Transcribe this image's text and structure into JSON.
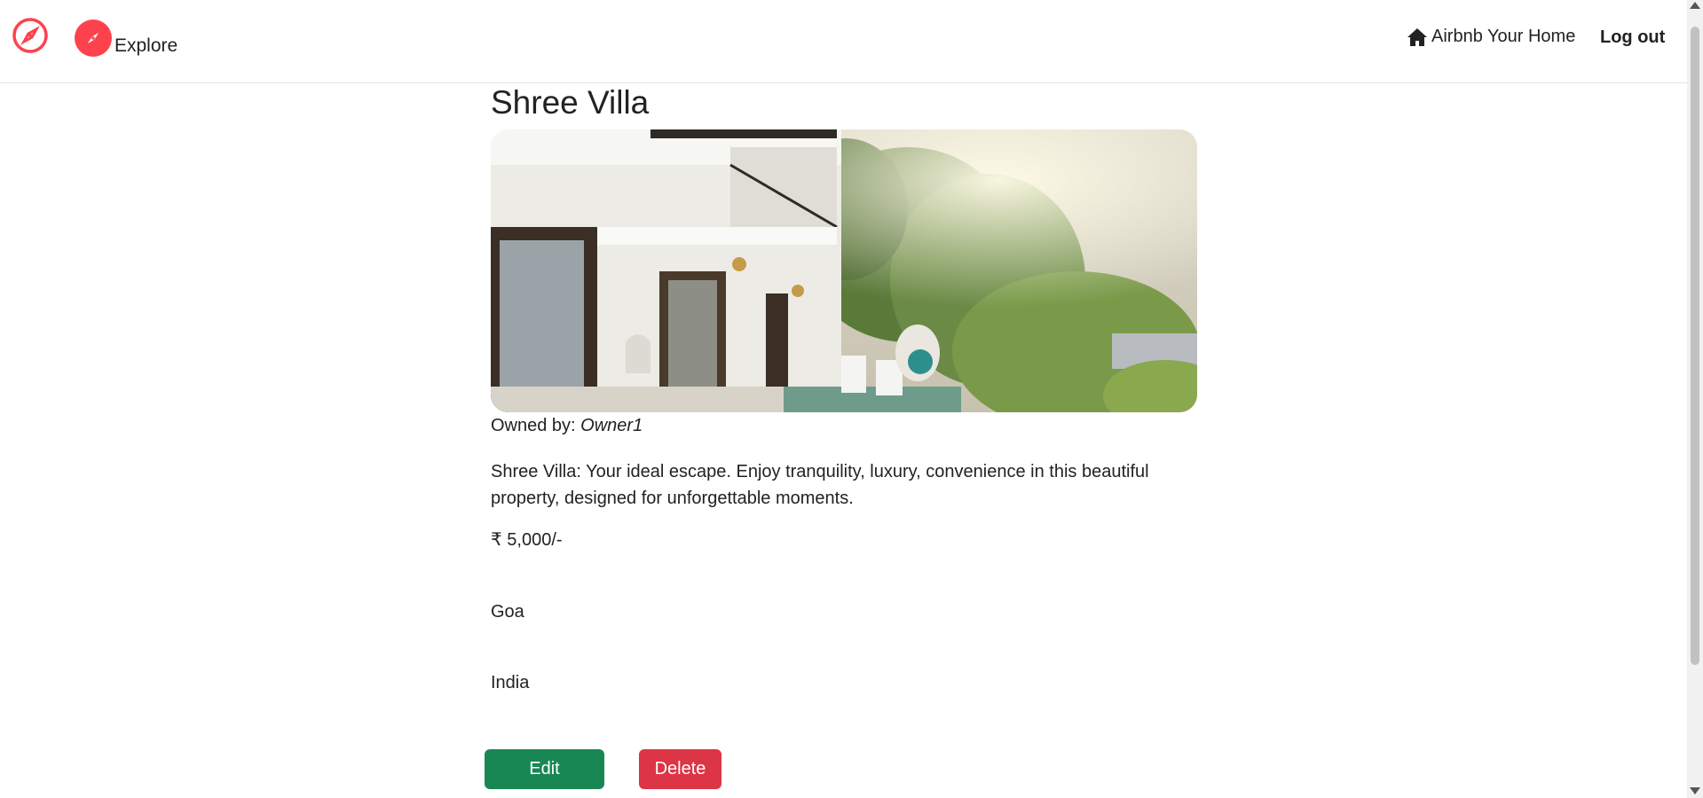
{
  "navbar": {
    "explore_label": "Explore",
    "host_label": "Airbnb Your Home",
    "logout_label": "Log out",
    "brand_color": "#fe424d",
    "icons": {
      "brand": "compass-icon",
      "explore": "compass-icon",
      "host": "house-icon"
    }
  },
  "listing": {
    "title": "Shree Villa",
    "owner_prefix": "Owned by:",
    "owner_name": "Owner1",
    "description": "Shree Villa: Your ideal escape. Enjoy tranquility, luxury, convenience in this beautiful property, designed for unforgettable moments.",
    "price": "₹ 5,000/-",
    "location": "Goa",
    "country": "India"
  },
  "actions": {
    "edit_label": "Edit",
    "delete_label": "Delete",
    "edit_color": "#198754",
    "delete_color": "#dc3545"
  }
}
